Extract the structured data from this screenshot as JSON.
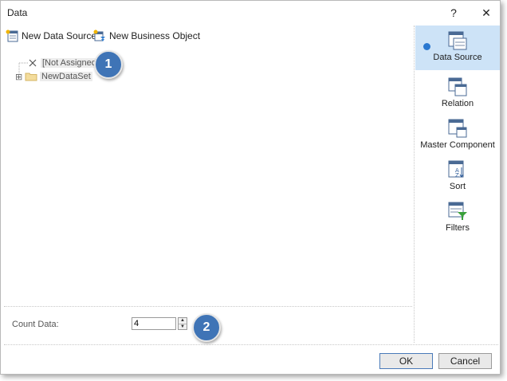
{
  "window": {
    "title": "Data",
    "help_label": "?",
    "close_label": "✕"
  },
  "toolbar": {
    "new_data_source": "New Data Source",
    "new_business_object": "New Business Object"
  },
  "tree": {
    "items": [
      {
        "label": "[Not Assigned]",
        "icon": "x-icon"
      },
      {
        "label": "NewDataSet",
        "icon": "folder-icon",
        "expander": "⊞"
      }
    ]
  },
  "badges": {
    "first": "1",
    "second": "2"
  },
  "count": {
    "label": "Count Data:",
    "value": "4"
  },
  "sidebar": {
    "items": [
      {
        "label": "Data Source",
        "icon": "data-source-icon",
        "selected": true
      },
      {
        "label": "Relation",
        "icon": "relation-icon"
      },
      {
        "label": "Master Component",
        "icon": "master-component-icon"
      },
      {
        "label": "Sort",
        "icon": "sort-icon"
      },
      {
        "label": "Filters",
        "icon": "filters-icon"
      }
    ]
  },
  "buttons": {
    "ok": "OK",
    "cancel": "Cancel"
  },
  "colors": {
    "accent": "#3f74b6",
    "selected_bg": "#cde3f7",
    "filter_green": "#3aa03a"
  }
}
